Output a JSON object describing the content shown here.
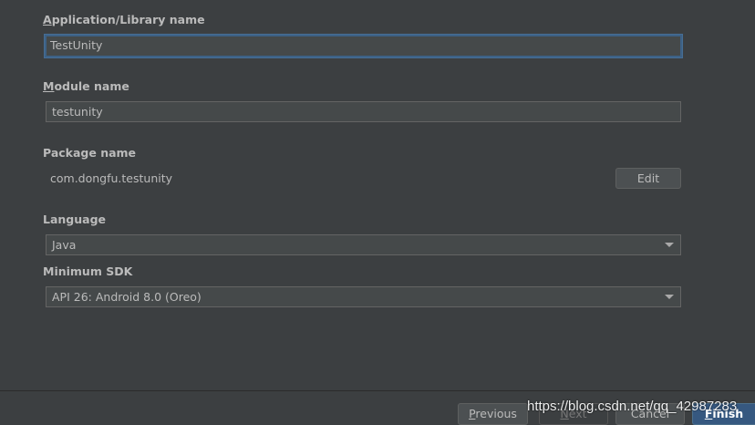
{
  "form": {
    "app_name": {
      "label_mnemonic": "A",
      "label_rest": "pplication/Library name",
      "value": "TestUnity"
    },
    "module_name": {
      "label_mnemonic": "M",
      "label_rest": "odule name",
      "value": "testunity"
    },
    "package_name": {
      "label": "Package name",
      "value": "com.dongfu.testunity",
      "edit_label": "Edit"
    },
    "language": {
      "label": "Language",
      "selected": "Java"
    },
    "min_sdk": {
      "label": "Minimum SDK",
      "selected": "API 26: Android 8.0 (Oreo)"
    }
  },
  "footer": {
    "previous_mnemonic": "P",
    "previous_rest": "revious",
    "next_mnemonic": "N",
    "next_rest": "ext",
    "cancel_label": "Cancel",
    "finish_mnemonic": "F",
    "finish_rest": "inish"
  },
  "watermark": "https://blog.csdn.net/qq_42987283",
  "colors": {
    "background": "#3c3f41",
    "field_bg": "#45494a",
    "focus_border": "#3d6185",
    "primary_button": "#365880",
    "text": "#bbbbbb"
  },
  "icons": {
    "dropdown_arrow": "chevron-down-icon"
  }
}
